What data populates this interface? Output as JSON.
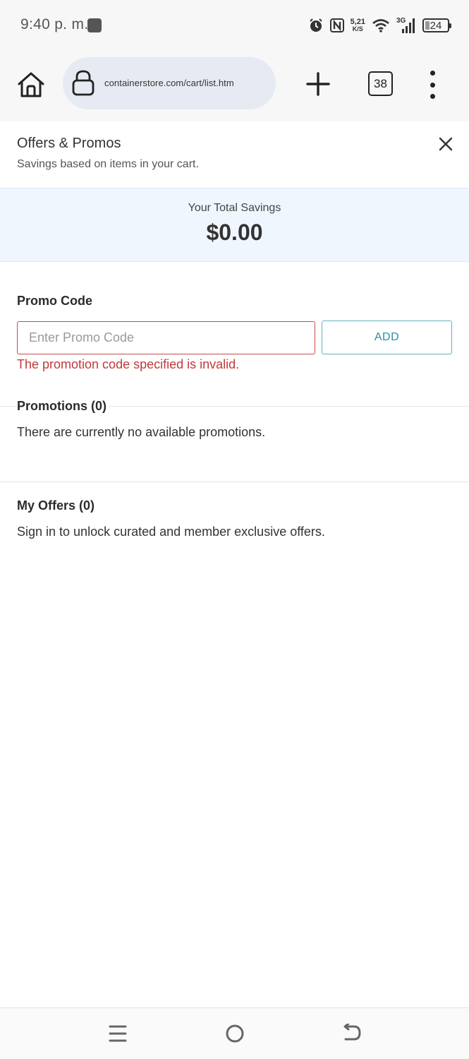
{
  "status_bar": {
    "time": "9:40 p. m.",
    "speed_value": "5,21",
    "speed_unit": "K/S",
    "network": "3G",
    "battery": "24",
    "icons": [
      "alarm-icon",
      "nfc-icon",
      "wifi-icon",
      "signal-icon",
      "battery-icon"
    ]
  },
  "browser": {
    "url": "containerstore.com/cart/list.htm",
    "tab_count": "38"
  },
  "panel": {
    "title": "Offers & Promos",
    "subtitle": "Savings based on items in your cart."
  },
  "savings": {
    "label": "Your Total Savings",
    "amount": "$0.00"
  },
  "promo": {
    "heading": "Promo Code",
    "placeholder": "Enter Promo Code",
    "value": "",
    "add_label": "ADD",
    "error": "The promotion code specified is invalid."
  },
  "promotions": {
    "heading": "Promotions (0)",
    "text": "There are currently no available promotions."
  },
  "offers": {
    "heading": "My Offers (0)",
    "text": "Sign in to unlock curated and member exclusive offers."
  },
  "colors": {
    "error": "#c0393b",
    "accent": "#2a8fa0",
    "savings_bg": "#eff6fd",
    "url_bg": "#e6eaf2"
  }
}
